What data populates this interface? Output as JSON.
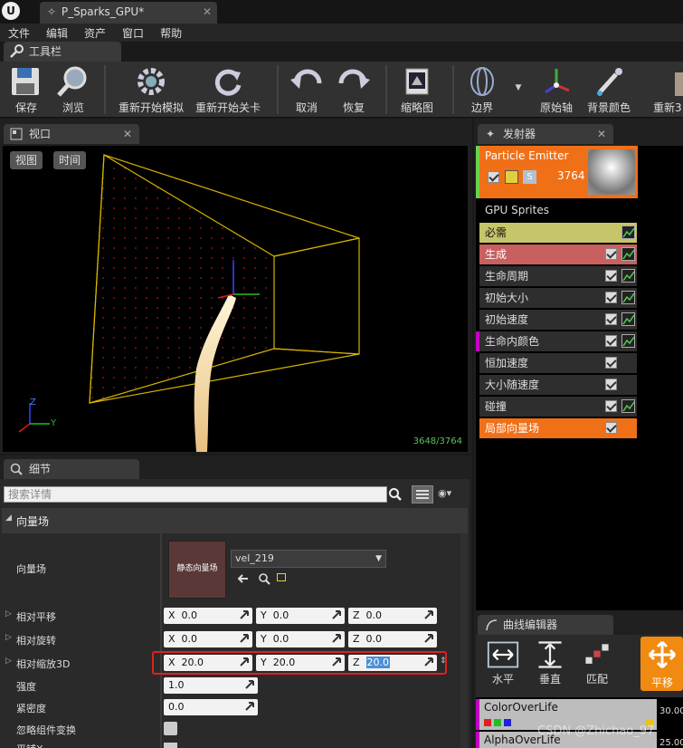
{
  "window": {
    "tab_title": "P_Sparks_GPU*"
  },
  "menu": [
    "文件",
    "编辑",
    "资产",
    "窗口",
    "帮助"
  ],
  "toolbar": {
    "tab": "工具栏",
    "buttons": [
      "保存",
      "浏览",
      "重新开始模拟",
      "重新开始关卡",
      "取消",
      "恢复",
      "缩略图",
      "边界",
      "原始轴",
      "背景颜色",
      "重新3"
    ]
  },
  "viewport": {
    "tab": "视口",
    "view_btn": "视图",
    "time_btn": "时间",
    "counter": "3648/3764",
    "axis_z": "Z",
    "axis_y": "Y"
  },
  "emitters": {
    "tab": "发射器",
    "emitter_name": "Particle Emitter",
    "emitter_count": "3764",
    "solo_label": "S",
    "type_label": "GPU Sprites",
    "modules": [
      {
        "label": "必需",
        "bg": "#c6c56a",
        "fg": "#111",
        "check": false,
        "graph": true
      },
      {
        "label": "生成",
        "bg": "#c86060",
        "fg": "#fff",
        "check": true,
        "graph": true
      },
      {
        "label": "生命周期",
        "bg": "#2e2e2e",
        "fg": "#ddd",
        "check": true,
        "graph": true
      },
      {
        "label": "初始大小",
        "bg": "#2e2e2e",
        "fg": "#ddd",
        "check": true,
        "graph": true
      },
      {
        "label": "初始速度",
        "bg": "#2e2e2e",
        "fg": "#ddd",
        "check": true,
        "graph": true
      },
      {
        "label": "生命内颜色",
        "bg": "#2e2e2e",
        "fg": "#ddd",
        "check": true,
        "graph": true,
        "marker": "#c400c4"
      },
      {
        "label": "恒加速度",
        "bg": "#2e2e2e",
        "fg": "#ddd",
        "check": true,
        "graph": false
      },
      {
        "label": "大小随速度",
        "bg": "#2e2e2e",
        "fg": "#ddd",
        "check": true,
        "graph": false
      },
      {
        "label": "碰撞",
        "bg": "#2e2e2e",
        "fg": "#ddd",
        "check": true,
        "graph": true
      },
      {
        "label": "局部向量场",
        "bg": "#f07018",
        "fg": "#fff",
        "check": true,
        "graph": false
      }
    ]
  },
  "details": {
    "tab": "细节",
    "search_placeholder": "搜索详情",
    "section": "向量场",
    "vf_label": "向量场",
    "vf_thumb": "静态向量场",
    "vf_asset": "vel_219",
    "rows": [
      {
        "label": "相对平移",
        "x": "0.0",
        "y": "0.0",
        "z": "0.0"
      },
      {
        "label": "相对旋转",
        "x": "0.0",
        "y": "0.0",
        "z": "0.0"
      },
      {
        "label": "相对缩放3D",
        "x": "20.0",
        "y": "20.0",
        "z": "20.0"
      }
    ],
    "intensity_label": "强度",
    "intensity": "1.0",
    "tightness_label": "紧密度",
    "tightness": "0.0",
    "ignore_label": "忽略组件变换",
    "cut_label": "平铺X"
  },
  "curve": {
    "tab": "曲线编辑器",
    "buttons": [
      "水平",
      "垂直",
      "匹配",
      "平移"
    ],
    "tracks": [
      "ColorOverLife",
      "AlphaOverLife"
    ],
    "axis_values": [
      "30.00",
      "25.00"
    ],
    "watermark": "CSDN @Zhichao_97"
  }
}
